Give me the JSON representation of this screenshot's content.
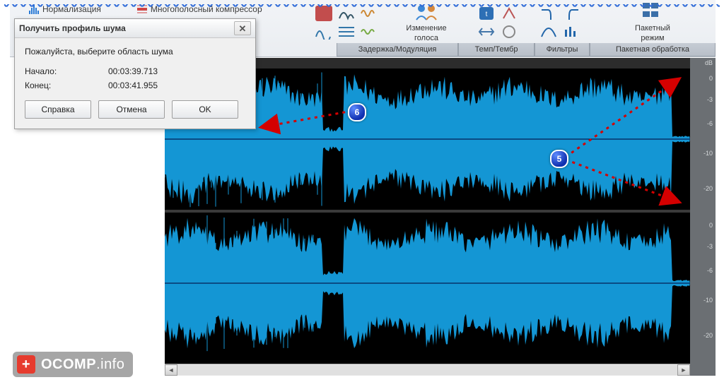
{
  "ribbon": {
    "row1": {
      "normalize": "Нормализация",
      "multiband": "Многополосный компрессор"
    },
    "voice_change": {
      "line1": "Изменение",
      "line2": "голоса"
    },
    "batch_mode": {
      "line1": "Пакетный",
      "line2": "режим"
    },
    "groups": {
      "delay_mod": "Задержка/Модуляция",
      "tempo": "Темп/Тембр",
      "filters": "Фильтры",
      "batch": "Пакетная обработка"
    }
  },
  "dialog": {
    "title": "Получить профиль шума",
    "message": "Пожалуйста, выберите область шума",
    "start_label": "Начало:",
    "start_value": "00:03:39.713",
    "end_label": "Конец:",
    "end_value": "00:03:41.955",
    "help": "Справка",
    "cancel": "Отмена",
    "ok": "OK"
  },
  "db_scale": {
    "unit": "dB",
    "ticks": [
      "0",
      "-3",
      "-6",
      "-10",
      "-20",
      "0",
      "-3",
      "-6",
      "-10",
      "-20"
    ]
  },
  "annotations": {
    "callout5": "5",
    "callout6": "6"
  },
  "watermark": {
    "text": "OCOMP",
    "suffix": ".info"
  }
}
